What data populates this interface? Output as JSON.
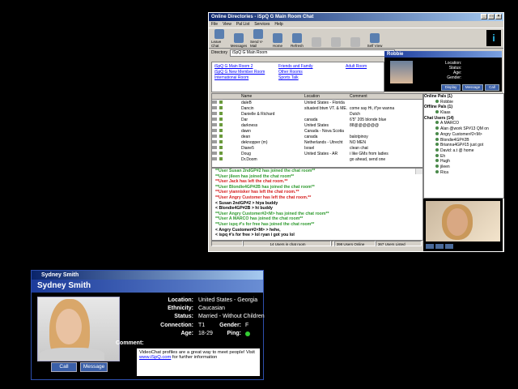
{
  "main_window": {
    "title": "Online Directories - iSpQ G Main Room Chat",
    "menu": [
      "File",
      "View",
      "Pal List",
      "Services",
      "Help"
    ],
    "toolbar": [
      "Leave Chat",
      "Messages",
      "Send V-Mail",
      "Home",
      "Refresh",
      "",
      "",
      "",
      "Self View"
    ],
    "directory_label": "Directory",
    "directory_value": "iSpQ G Main Room",
    "rooms_col1": [
      "iSpQ G Main Room 2",
      "iSpQ G New Member Room",
      "International Room"
    ],
    "rooms_col2": [
      "Friends and Family",
      "Other Rooms",
      "Sports Talk"
    ],
    "rooms_col3": [
      "Adult Room"
    ],
    "profile": {
      "name": "Robbie",
      "labels": [
        "Location:",
        "Status:",
        "Age:",
        "Gender:"
      ],
      "buttons": [
        "Display",
        "Message",
        "Call"
      ]
    },
    "user_columns": [
      "Name",
      "Location",
      "Comment"
    ],
    "users": [
      {
        "name": "daleB",
        "location": "United States - Florida",
        "comment": ""
      },
      {
        "name": "Dancin",
        "location": "situated btwn VT. & ME.",
        "comment": "come say Hi, if'ye wanna"
      },
      {
        "name": "Danielle & Richard",
        "location": "",
        "comment": "Dutch"
      },
      {
        "name": "Dar",
        "location": "canada",
        "comment": "6'5\" 205 blonde blue"
      },
      {
        "name": "darkness",
        "location": "United States",
        "comment": "88@@@@@@"
      },
      {
        "name": "dawn",
        "location": "Canada - Nova Scotia",
        "comment": ""
      },
      {
        "name": "dean",
        "location": "canada",
        "comment": "balotpinoy"
      },
      {
        "name": "deknopper (m)",
        "location": "Netherlands - Utrecht",
        "comment": "NO MEN"
      },
      {
        "name": "Diane5",
        "location": "Israel",
        "comment": "clean chat"
      },
      {
        "name": "Doug",
        "location": "United States - AR",
        "comment": "i like GMs from ladies"
      },
      {
        "name": "Dr.Doom",
        "location": "",
        "comment": "go ahead, send one"
      }
    ],
    "chat_lines": [
      {
        "text": "**User Susan 2ndGP#2 has joined the chat room**",
        "color": "#2e9a2e"
      },
      {
        "text": "**User jileen has joined the chat room**",
        "color": "#2e9a2e"
      },
      {
        "text": "**User Jack has left the chat room.**",
        "color": "#d62020"
      },
      {
        "text": "**User Blondie4GP#2B has joined the chat room**",
        "color": "#2e9a2e"
      },
      {
        "text": "**User yiannisker has left the chat room.**",
        "color": "#d62020"
      },
      {
        "text": "**User Angry Customer has left the chat room.**",
        "color": "#d62020"
      },
      {
        "text": "< Susan 2ndGP#2 > hiya buddy",
        "color": "#000000"
      },
      {
        "text": "< Blondie4GP#2B > hi buddy",
        "color": "#000000"
      },
      {
        "text": "**User Angry Customer#2<M> has joined the chat room**",
        "color": "#2e9a2e"
      },
      {
        "text": "**User A MARCO has joined the chat room**",
        "color": "#2e9a2e"
      },
      {
        "text": "**User ispq #'s for free has joined the chat room**",
        "color": "#2e9a2e"
      },
      {
        "text": "< Angry Customer#2<M> > hehe,",
        "color": "#000000"
      },
      {
        "text": "< ispq #'s for free > lol ryan i got you lol",
        "color": "#000000"
      }
    ],
    "tree": {
      "online_pals": "Online Pals (1)",
      "online_pals_items": [
        "Robbie"
      ],
      "offline_pals": "Offline Pals (1)",
      "offline_pals_items": [
        "Klaas"
      ],
      "chat_users": "Chat Users (14)",
      "chat_users_items": [
        "A MARCO",
        "Alan @work SP#13 QM on",
        "Angry Customer#2<M>",
        "Blondie4GP#2B",
        "Brianna4GP#15 just got",
        "David: a.t @ home",
        "Eh",
        "Hugh",
        "jileen",
        "Rica"
      ]
    },
    "status_bar": [
      "",
      "14 Users in chat room",
      "",
      "398 Users Online",
      "367 Users Listed"
    ]
  },
  "popup": {
    "title": "Sydney Smith",
    "header": "Sydney Smith",
    "location_label": "Location:",
    "location": "United States - Georgia",
    "ethnicity_label": "Ethnicity:",
    "ethnicity": "Caucasian",
    "status_label": "Status:",
    "status": "Married - Without Children",
    "connection_label": "Connection:",
    "connection": "T1",
    "gender_label": "Gender:",
    "gender": "F",
    "age_label": "Age:",
    "age": "18-29",
    "ping_label": "Ping:",
    "comment_label": "Comment:",
    "comment_text": "VideoChat profiles are a great way to meet people! Visit ",
    "comment_link": "www.iSpQ.com",
    "comment_tail": " for further information",
    "call_button": "Call",
    "message_button": "Message"
  }
}
